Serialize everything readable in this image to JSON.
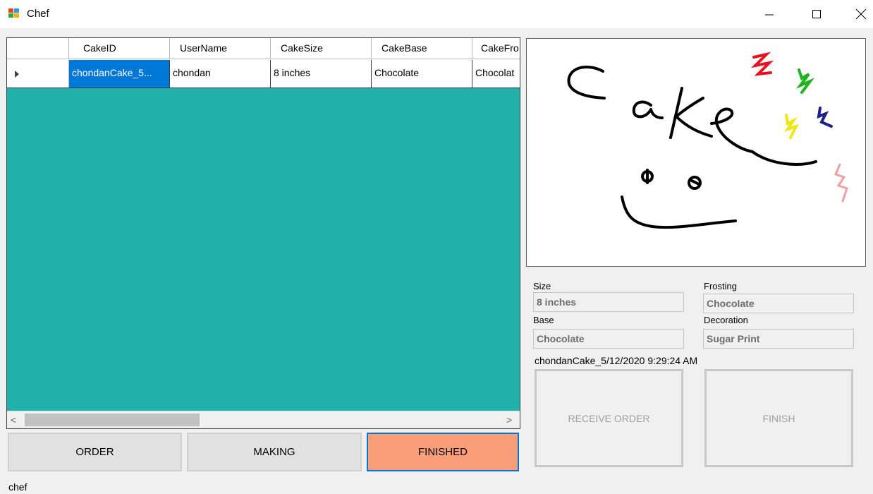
{
  "window": {
    "title": "Chef",
    "minimize": "—",
    "maximize": "☐",
    "close": "✕"
  },
  "grid": {
    "columns": [
      "CakeID",
      "UserName",
      "CakeSize",
      "CakeBase",
      "CakeFro"
    ],
    "rows": [
      {
        "cells": [
          "chondanCake_5...",
          "chondan",
          "8 inches",
          "Chocolate",
          "Chocolat"
        ]
      }
    ],
    "scroll_left": "<",
    "scroll_right": ">"
  },
  "buttons": {
    "order": "ORDER",
    "making": "MAKING",
    "finished": "FINISHED",
    "receive": "RECEIVE ORDER",
    "finish": "FINISH"
  },
  "details": {
    "size_label": "Size",
    "size_value": "8 inches",
    "frosting_label": "Frosting",
    "frosting_value": "Chocolate",
    "base_label": "Base",
    "base_value": "Chocolate",
    "decoration_label": "Decoration",
    "decoration_value": "Sugar Print",
    "order_id": "chondanCake_5/12/2020 9:29:24 AM"
  },
  "picture": {
    "drawn_text": "Cake"
  },
  "status": {
    "user": "chef"
  },
  "colors": {
    "grid_bg": "#20b2aa",
    "selected_cell": "#0078d7",
    "finished_btn": "#fa9e7a"
  }
}
